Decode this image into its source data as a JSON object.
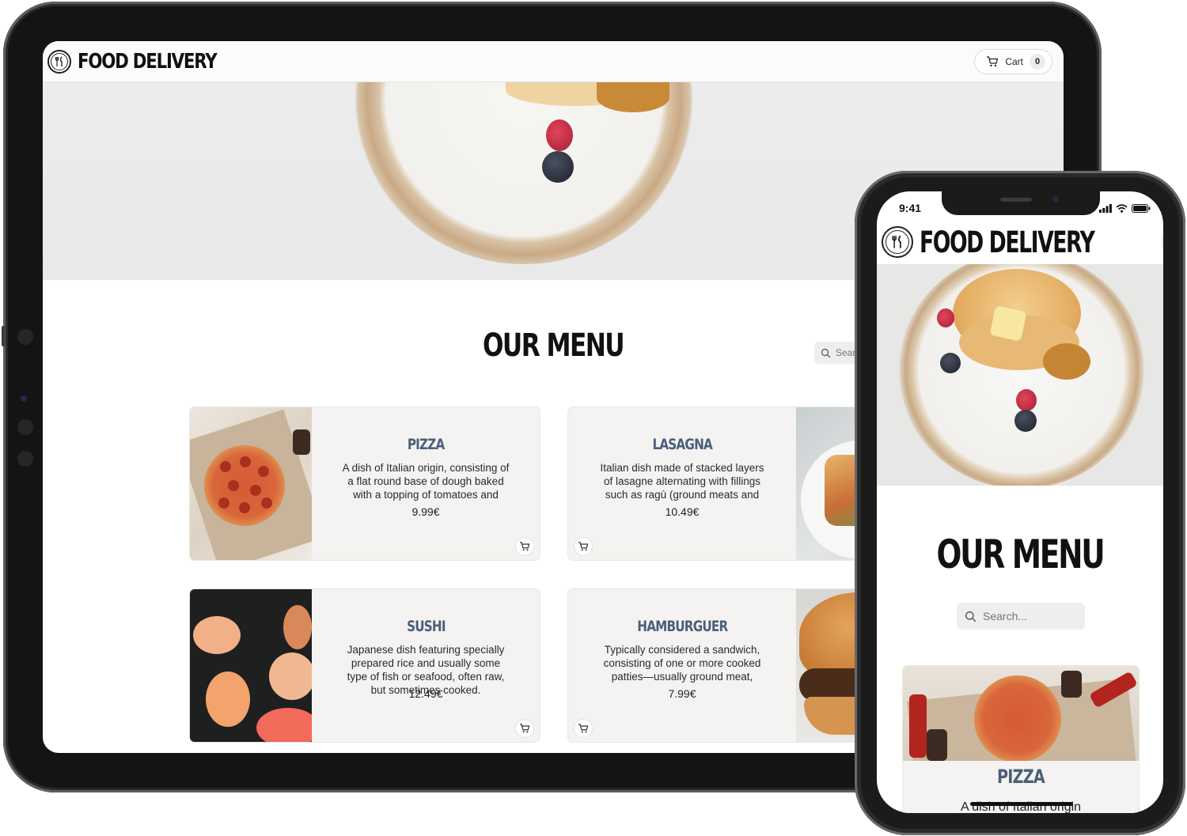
{
  "brand": {
    "name": "FOOD DELIVERY"
  },
  "cart": {
    "label": "Cart",
    "count": "0"
  },
  "menu": {
    "title": "OUR MENU",
    "search_placeholder": "Search...",
    "items": [
      {
        "name": "PIZZA",
        "description": "A dish of Italian origin, consisting of a flat round base of dough baked with a topping of tomatoes and cheese, typically with added mea...",
        "price": "9.99€"
      },
      {
        "name": "LASAGNA",
        "description": "Italian dish made of stacked layers of lasagne alternating with fillings such as ragù (ground meats and tomato sauce), vegetables,...",
        "price": "10.49€"
      },
      {
        "name": "SUSHI",
        "description": "Japanese dish featuring specially prepared rice and usually some type of fish or seafood, often raw, but sometimes cooked.",
        "price": "12.49€"
      },
      {
        "name": "HAMBURGUER",
        "description": "Typically considered a sandwich, consisting of one or more cooked patties—usually ground meat, typically beef—placed inside a...",
        "price": "7.99€"
      }
    ]
  },
  "phone": {
    "time": "9:41",
    "first_card_title": "PIZZA",
    "first_card_desc": "A dish of Italian origin"
  },
  "icons": {
    "logo": "fork-knife-icon",
    "cart": "shopping-cart-icon",
    "search": "search-icon",
    "add_to_cart": "add-to-cart-icon",
    "signal": "signal-icon",
    "wifi": "wifi-icon",
    "battery": "battery-icon"
  },
  "colors": {
    "card_title": "#4a5f78",
    "card_background": "#f4f3f1",
    "device_frame": "#141414"
  }
}
